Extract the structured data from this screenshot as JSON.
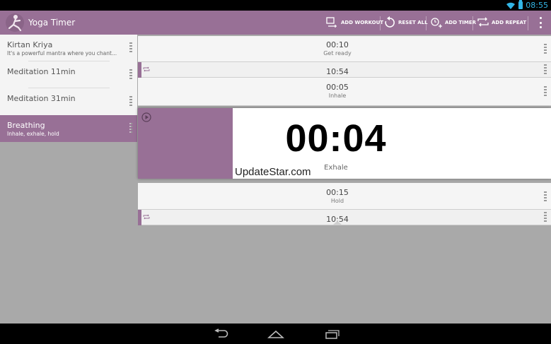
{
  "status_bar": {
    "time": "08:55",
    "wifi_icon": "wifi-icon",
    "battery_icon": "battery-icon"
  },
  "action_bar": {
    "title": "Yoga Timer",
    "logo_icon": "yoga-pose-icon",
    "actions": [
      {
        "label": "ADD WORKOUT",
        "icon": "add-workout-icon"
      },
      {
        "label": "RESET ALL",
        "icon": "reset-icon"
      },
      {
        "label": "ADD TIMER",
        "icon": "add-timer-icon"
      },
      {
        "label": "ADD REPEAT",
        "icon": "add-repeat-icon"
      }
    ],
    "overflow_icon": "overflow-menu-icon"
  },
  "workouts": [
    {
      "title": "Kirtan Kriya",
      "subtitle": "It's a powerful mantra where you chant..."
    },
    {
      "title": "Meditation 11min",
      "subtitle": ""
    },
    {
      "title": "Meditation 31min",
      "subtitle": ""
    },
    {
      "title": "Breathing",
      "subtitle": "Inhale, exhale, hold",
      "selected": true
    }
  ],
  "timers": {
    "get_ready": {
      "time": "00:10",
      "label": "Get ready"
    },
    "repeat_1": {
      "time": "10:54"
    },
    "inhale": {
      "time": "00:05",
      "label": "Inhale"
    },
    "active": {
      "time": "00:04",
      "label": "Exhale",
      "progress": 0.23
    },
    "hold": {
      "time": "00:15",
      "label": "Hold"
    },
    "repeat_2": {
      "time": "10:54"
    }
  },
  "watermark": "UpdateStar.com",
  "colors": {
    "accent": "#987096",
    "background": "#a9a9a9",
    "status_text": "#33b5e5"
  },
  "nav_bar": {
    "back_icon": "back-icon",
    "home_icon": "home-icon",
    "recents_icon": "recents-icon"
  }
}
